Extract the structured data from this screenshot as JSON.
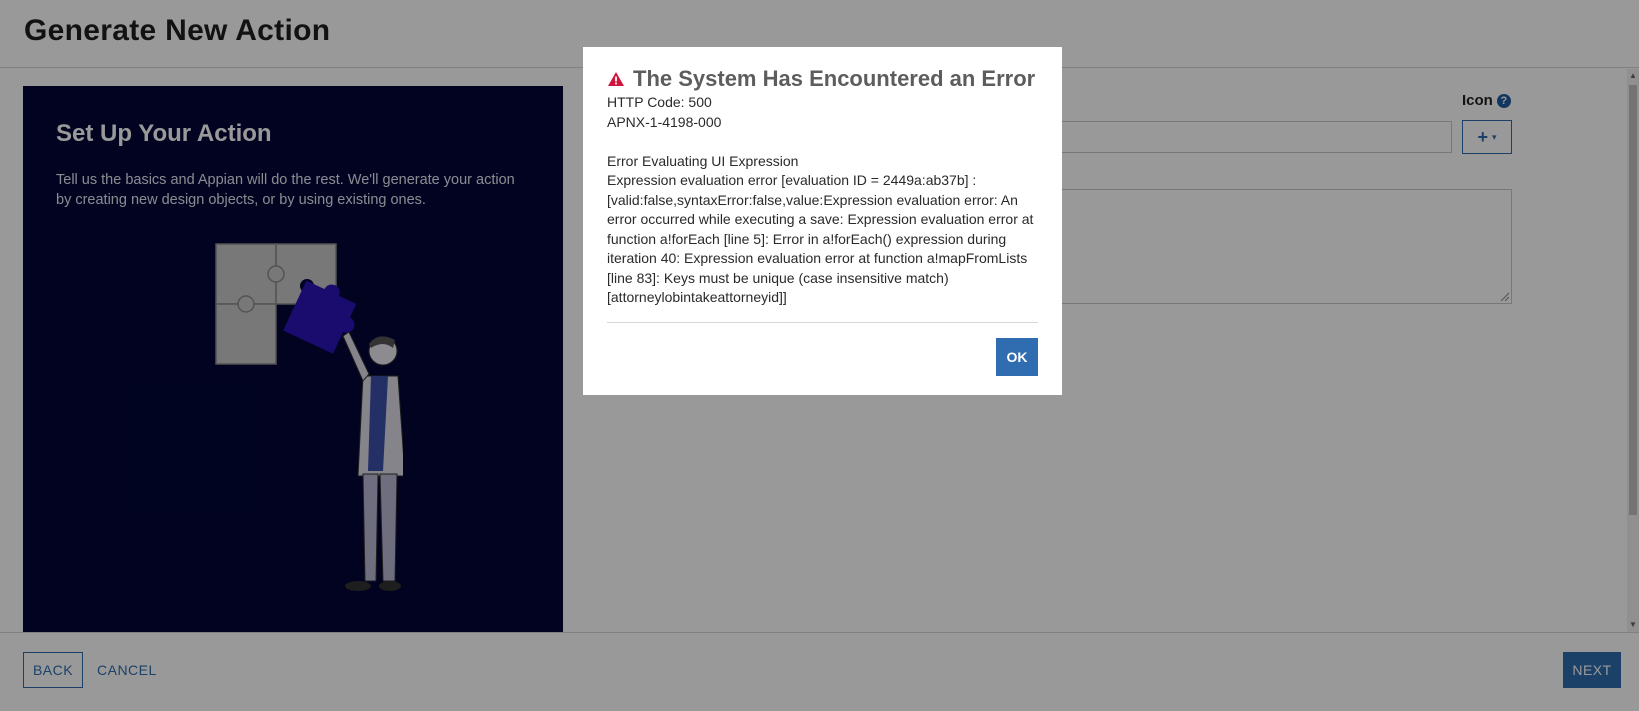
{
  "page": {
    "title": "Generate New Action"
  },
  "hero": {
    "title": "Set Up Your Action",
    "description": "Tell us the basics and Appian will do the rest. We'll generate your action by creating new design objects, or by using existing ones."
  },
  "form": {
    "icon_label": "Icon",
    "help_glyph": "?",
    "icon_picker_glyph": "+",
    "icon_picker_caret": "▾"
  },
  "footer": {
    "back_label": "BACK",
    "cancel_label": "CANCEL",
    "next_label": "NEXT"
  },
  "dialog": {
    "title": "The System Has Encountered an Error",
    "http_code": "HTTP Code: 500",
    "error_id": "APNX-1-4198-000",
    "error_heading": "Error Evaluating UI Expression",
    "error_detail": "Expression evaluation error [evaluation ID = 2449a:ab37b] : [valid:false,syntaxError:false,value:Expression evaluation error: An error occurred while executing a save: Expression evaluation error at function a!forEach [line 5]: Error in a!forEach() expression during iteration 40: Expression evaluation error at function a!mapFromLists [line 83]: Keys must be unique (case insensitive match) [attorneylobintakeattorneyid]]",
    "ok_label": "OK",
    "icon": "warning-triangle-icon"
  },
  "colors": {
    "primary": "#2f6db0",
    "hero_bg": "#020637",
    "warning": "#d0143c",
    "puzzle_accent": "#2a14b8"
  }
}
